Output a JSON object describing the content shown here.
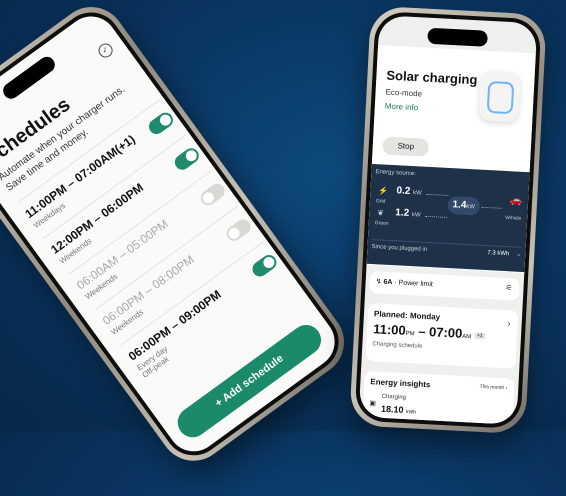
{
  "left_phone": {
    "title": "Schedules",
    "subtitle": "Automate when your charger runs. Save time and money.",
    "schedules": [
      {
        "time": "11:00PM – 07:00AM(+1)",
        "days": "Weekdays",
        "note": "",
        "enabled": true
      },
      {
        "time": "12:00PM – 06:00PM",
        "days": "Weekends",
        "note": "",
        "enabled": true
      },
      {
        "time": "06:00AM – 05:00PM",
        "days": "Weekends",
        "note": "",
        "enabled": false
      },
      {
        "time": "06:00PM – 08:00PM",
        "days": "Weekends",
        "note": "",
        "enabled": false
      },
      {
        "time": "06:00PM – 09:00PM",
        "days": "Every day",
        "note": "Off-peak",
        "enabled": true
      }
    ],
    "add_button": "+ Add schedule"
  },
  "right_phone": {
    "title": "Solar charging",
    "mode": "Eco-mode",
    "more_info": "More info",
    "stop": "Stop",
    "energy": {
      "label": "Energy source:",
      "grid_value": "0.2",
      "grid_unit": "kW",
      "grid_label": "Grid",
      "green_value": "1.2",
      "green_unit": "kW",
      "green_label": "Green",
      "total_value": "1.4",
      "total_unit": "kW",
      "vehicle_label": "Vehicle",
      "since_label": "Since you plugged in",
      "since_value": "7.3 kWh"
    },
    "power": {
      "amps": "6A",
      "label": "Power limit"
    },
    "planned": {
      "heading": "Planned: Monday",
      "start": "11:00",
      "start_ampm": "PM",
      "end": "07:00",
      "end_ampm": "AM",
      "plus": "+1",
      "subtitle": "Charging schedule"
    },
    "insights": {
      "heading": "Energy insights",
      "period": "This month",
      "metric_label": "Charging",
      "metric_value": "18.10",
      "metric_unit": "kWh"
    }
  },
  "colors": {
    "accent": "#1a8a6a",
    "background": "#0a3763",
    "energy_panel": "#1f3148"
  }
}
